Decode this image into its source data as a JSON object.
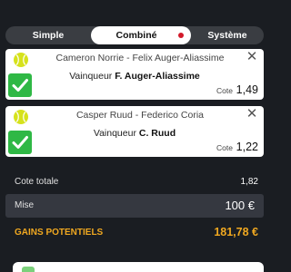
{
  "tabs": {
    "simple": "Simple",
    "combine": "Combiné",
    "systeme": "Système"
  },
  "selections": [
    {
      "match": "Cameron Norrie - Felix Auger-Aliassime",
      "winner_prefix": "Vainqueur ",
      "winner_name": "F. Auger-Aliassime",
      "cote_label": "Cote",
      "cote_value": "1,49"
    },
    {
      "match": "Casper Ruud - Federico Coria",
      "winner_prefix": "Vainqueur ",
      "winner_name": "C. Ruud",
      "cote_label": "Cote",
      "cote_value": "1,22"
    }
  ],
  "summary": {
    "cote_totale_label": "Cote totale",
    "cote_totale_value": "1,82",
    "mise_label": "Mise",
    "mise_value": "100 €",
    "gains_label": "GAINS POTENTIELS",
    "gains_value": "181,78 €"
  },
  "icons": {
    "sport": "tennis-ball-icon",
    "selected": "checkmark-icon",
    "remove": "close-icon"
  },
  "colors": {
    "accent": "#f0a820",
    "check": "#2fb845",
    "ball": "#d6e21c",
    "notification_dot": "#d21a2a"
  }
}
